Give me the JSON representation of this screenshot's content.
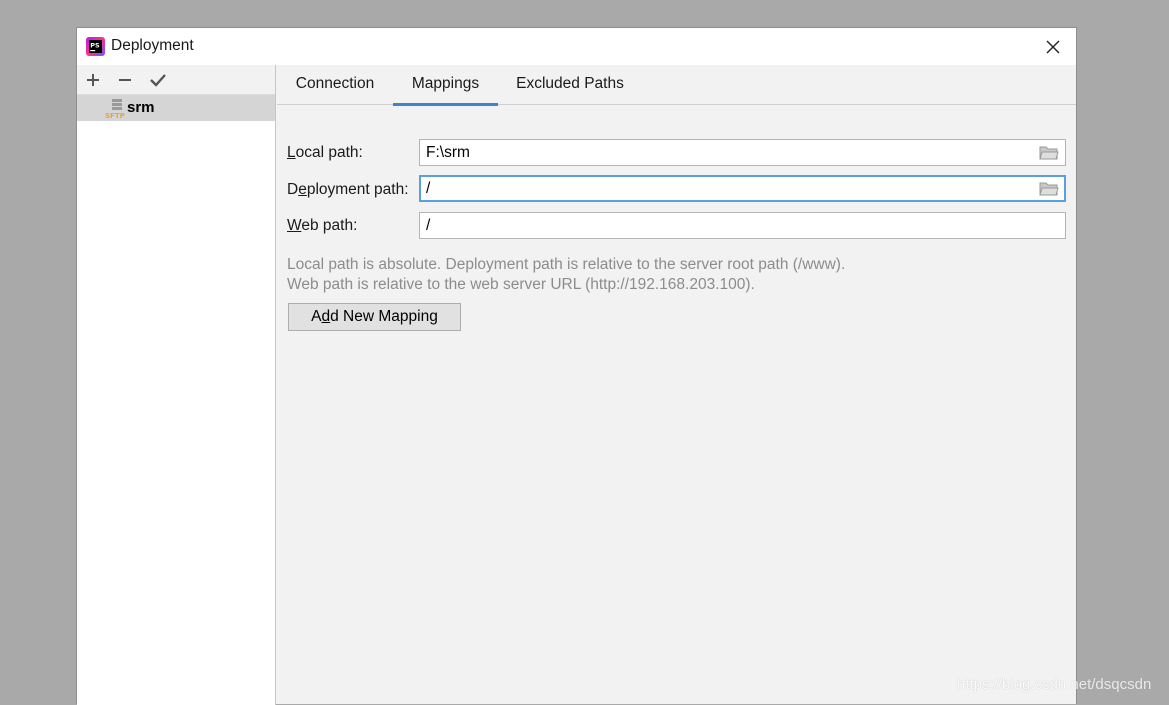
{
  "window": {
    "title": "Deployment",
    "app_icon": "phpstorm-logo-icon",
    "close_icon": "close-icon"
  },
  "left_toolbar": {
    "add_icon": "plus-icon",
    "remove_icon": "minus-icon",
    "apply_icon": "checkmark-icon"
  },
  "servers": [
    {
      "name": "srm",
      "icon": "sftp-server-icon",
      "icon_text": "SFTP",
      "selected": true
    }
  ],
  "tabs": [
    {
      "label": "Connection",
      "active": false
    },
    {
      "label": "Mappings",
      "active": true
    },
    {
      "label": "Excluded Paths",
      "active": false
    }
  ],
  "mappings": {
    "local_path": {
      "label_mnemonic": "L",
      "label_rest": "ocal path:",
      "value": "F:\\srm"
    },
    "deployment_path": {
      "label_pre": "D",
      "label_mnemonic": "e",
      "label_rest": "ployment path:",
      "value": "/"
    },
    "web_path": {
      "label_mnemonic": "W",
      "label_rest": "eb path:",
      "value": "/"
    },
    "hint_line1": "Local path is absolute. Deployment path is relative to the server root path (/www).",
    "hint_line2": "Web path is relative to the web server URL (http://192.168.203.100).",
    "add_button": {
      "pre": "A",
      "mnemonic": "d",
      "rest": "d New Mapping"
    }
  },
  "watermark": "https://blog.csdn.net/dsqcsdn",
  "colors": {
    "accent": "#4083c9",
    "focus_border": "#5a9fe0",
    "hint_text": "#8c8c8c",
    "selection": "#d5d5d5"
  }
}
